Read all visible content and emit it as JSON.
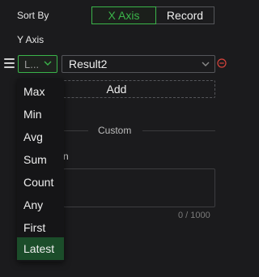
{
  "sort_by": {
    "label": "Sort By",
    "options": [
      "X Axis",
      "Record"
    ],
    "selected": "X Axis"
  },
  "y_axis": {
    "label": "Y Axis",
    "aggregation": {
      "value": "L...",
      "icon": "chevron-down-icon"
    },
    "field": {
      "value": "Result2",
      "icon": "chevron-down-icon"
    },
    "remove_icon": "remove-circle-icon",
    "drag_icon": "drag-handle-icon",
    "add_label": "Add"
  },
  "custom": {
    "title": "Custom",
    "desc_label_partial": "n",
    "textarea_value": "",
    "counter": "0 / 1000"
  },
  "aggregation_menu": {
    "items": [
      "Max",
      "Min",
      "Avg",
      "Sum",
      "Count",
      "Any",
      "First",
      "Latest"
    ],
    "active": "Latest"
  },
  "colors": {
    "accent": "#3bb54a",
    "danger": "#d9443c",
    "active_bg": "#1b4d2a"
  }
}
